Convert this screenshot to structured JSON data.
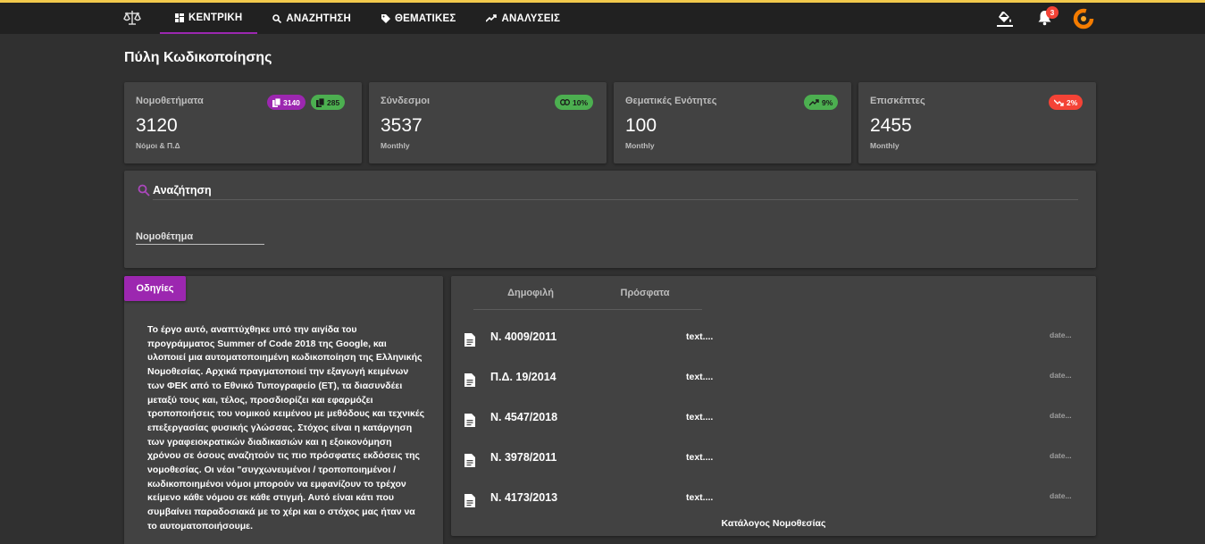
{
  "nav": {
    "items": [
      {
        "label": "ΚΕΝΤΡΙΚΗ",
        "icon": "dashboard-icon",
        "active": true
      },
      {
        "label": "ΑΝΑΖΗΤΗΣΗ",
        "icon": "search-icon"
      },
      {
        "label": "ΘΕΜΑΤΙΚΕΣ",
        "icon": "label-icon"
      },
      {
        "label": "ΑΝΑΛΥΣΕΙΣ",
        "icon": "trending-icon"
      }
    ],
    "notifications_count": "3"
  },
  "page_title": "Πύλη Κωδικοποίησης",
  "stats": [
    {
      "label": "Νομοθετήματα",
      "value": "3120",
      "sub": "Νόμοι & Π.Δ",
      "chips": [
        {
          "text": "3140",
          "color": "#9c27b0"
        },
        {
          "text": "285",
          "color": "#4caf50"
        }
      ]
    },
    {
      "label": "Σύνδεσμοι",
      "value": "3537",
      "sub": "Monthly",
      "chip": "10%",
      "color": "#4caf50"
    },
    {
      "label": "Θεματικές Ενότητες",
      "value": "100",
      "sub": "Monthly",
      "chip": "9%",
      "color": "#4caf50"
    },
    {
      "label": "Επισκέπτες",
      "value": "2455",
      "sub": "Monthly",
      "chip": "2%",
      "color": "#f44336"
    }
  ],
  "search": {
    "title": "Αναζήτηση",
    "placeholder": "Νομοθέτημα"
  },
  "guide": {
    "button": "Οδηγίες",
    "text": "Το έργο αυτό, αναπτύχθηκε υπό την αιγίδα του προγράμματος Summer of Code 2018 της Google, και υλοποιεί μια αυτοματοποιημένη κωδικοποίηση της Ελληνικής Νομοθεσίας. Αρχικά πραγματοποιεί την εξαγωγή κειμένων των ΦΕΚ από το Εθνικό Τυπογραφείο (ΕΤ), τα διασυνδέει μεταξύ τους και, τέλος, προσδιορίζει και εφαρμόζει τροποποιήσεις του νομικού κειμένου με μεθόδους και τεχνικές επεξεργασίας φυσικής γλώσσας. Στόχος είναι η κατάργηση των γραφειοκρατικών διαδικασιών και η εξοικονόμηση χρόνου σε όσους αναζητούν τις πιο πρόσφατες εκδόσεις της νομοθεσίας. Οι νέοι \"συγχωνευμένοι / τροποποιημένοι / κωδικοποιημένοι νόμοι μπορούν να εμφανίζουν το τρέχον κείμενο κάθε νόμου σε κάθε στιγμή. Αυτό είναι κάτι που συμβαίνει παραδοσιακά με το χέρι και ο στόχος μας ήταν να το αυτοματοποιήσουμε."
  },
  "laws": {
    "tabs": [
      "Δημοφιλή",
      "Πρόσφατα"
    ],
    "rows": [
      {
        "title": "Ν. 4009/2011",
        "text": "text....",
        "date": "date..."
      },
      {
        "title": "Π.Δ. 19/2014",
        "text": "text....",
        "date": "date..."
      },
      {
        "title": "Ν. 4547/2018",
        "text": "text....",
        "date": "date..."
      },
      {
        "title": "Ν. 3978/2011",
        "text": "text....",
        "date": "date..."
      },
      {
        "title": "Ν. 4173/2013",
        "text": "text....",
        "date": "date..."
      }
    ],
    "catalog": "Κατάλογος Νομοθεσίας"
  }
}
